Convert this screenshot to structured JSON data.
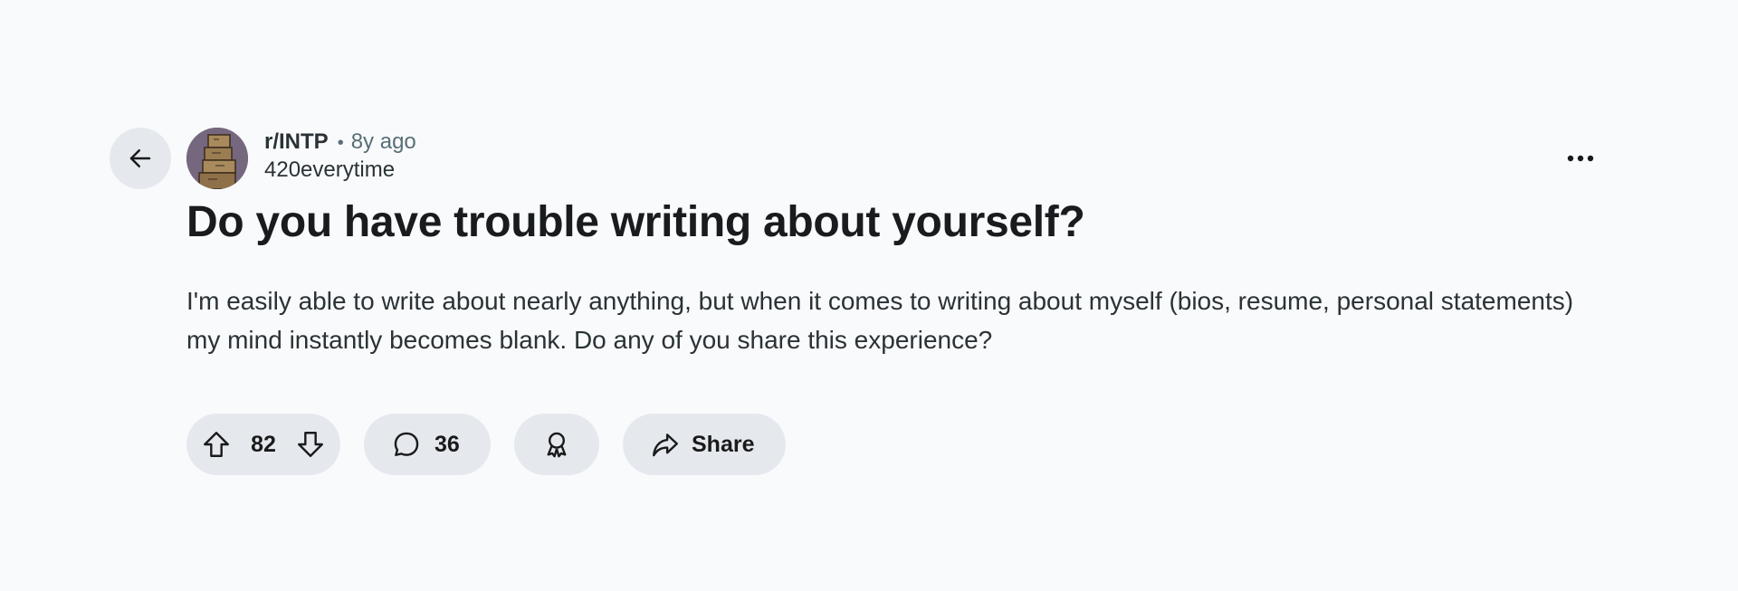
{
  "post": {
    "subreddit": "r/INTP",
    "separator": "•",
    "time_ago": "8y ago",
    "author": "420everytime",
    "title": "Do you have trouble writing about yourself?",
    "body": "I'm easily able to write about nearly anything, but when it comes to writing about myself (bios, resume, personal statements) my mind instantly becomes blank. Do any of you share this experience?"
  },
  "actions": {
    "vote_count": "82",
    "comment_count": "36",
    "share_label": "Share"
  },
  "icons": {
    "back": "arrow-left-icon",
    "more": "more-horizontal-icon",
    "upvote": "upvote-arrow-icon",
    "downvote": "downvote-arrow-icon",
    "comment": "comment-bubble-icon",
    "award": "award-icon",
    "share": "share-arrow-icon"
  },
  "colors": {
    "background": "#f9fafc",
    "pill": "#e5e9ee",
    "text": "#1a1a1b",
    "meta": "#576f76"
  }
}
